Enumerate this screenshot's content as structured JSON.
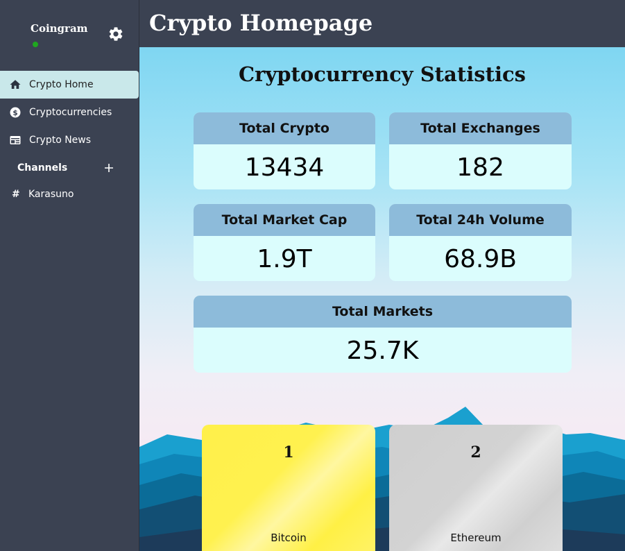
{
  "app": {
    "brand": "Coingram",
    "page_title": "Crypto Homepage"
  },
  "sidebar": {
    "items": [
      {
        "label": "Crypto Home",
        "icon": "home-icon",
        "active": true
      },
      {
        "label": "Cryptocurrencies",
        "icon": "dollar-icon",
        "active": false
      },
      {
        "label": "Crypto News",
        "icon": "news-icon",
        "active": false
      }
    ],
    "channels_label": "Channels",
    "channels": [
      {
        "label": "Karasuno"
      }
    ]
  },
  "stats": {
    "title": "Cryptocurrency Statistics",
    "cards": [
      {
        "label": "Total Crypto",
        "value": "13434"
      },
      {
        "label": "Total Exchanges",
        "value": "182"
      },
      {
        "label": "Total Market Cap",
        "value": "1.9T"
      },
      {
        "label": "Total 24h Volume",
        "value": "68.9B"
      },
      {
        "label": "Total Markets",
        "value": "25.7K"
      }
    ]
  },
  "coins": [
    {
      "rank": "1",
      "name": "Bitcoin"
    },
    {
      "rank": "2",
      "name": "Ethereum"
    }
  ],
  "colors": {
    "sidebar_bg": "#3b4252",
    "active_item_bg": "#c9e8ea",
    "card_header_bg": "#8dbbda",
    "card_body_bg": "#dbfdfd",
    "online_status": "#1fa71f"
  }
}
